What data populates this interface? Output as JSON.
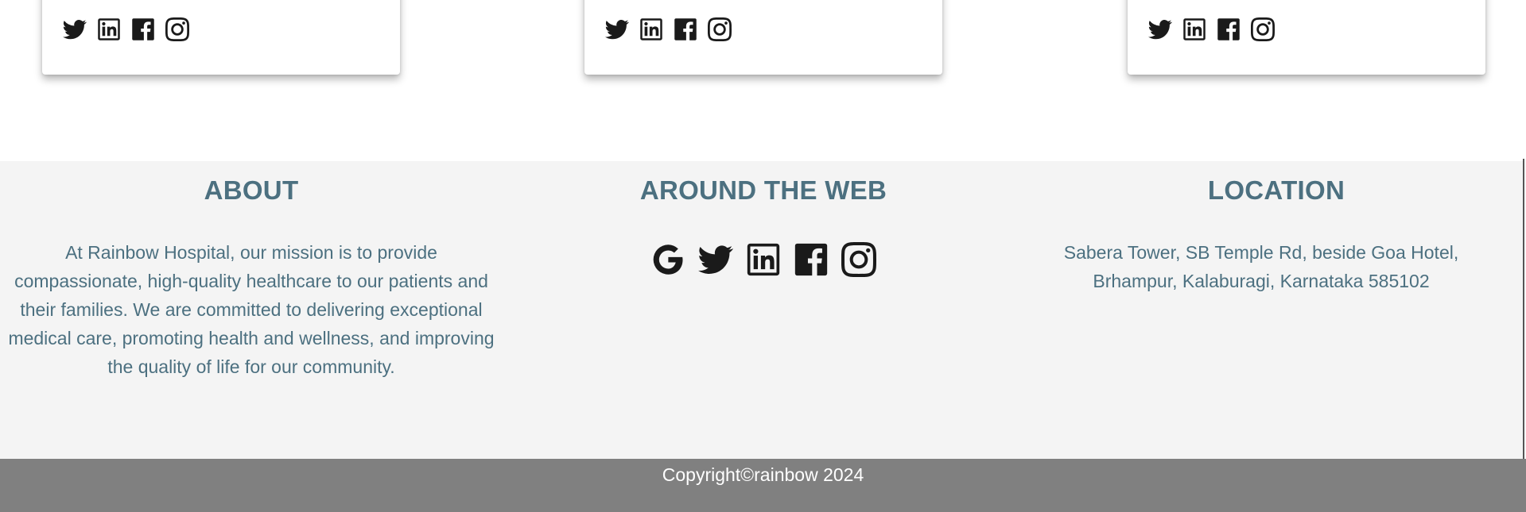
{
  "cards": [
    {
      "social": [
        "twitter-icon",
        "linkedin-icon",
        "facebook-icon",
        "instagram-icon"
      ]
    },
    {
      "social": [
        "twitter-icon",
        "linkedin-icon",
        "facebook-icon",
        "instagram-icon"
      ]
    },
    {
      "social": [
        "twitter-icon",
        "linkedin-icon",
        "facebook-icon",
        "instagram-icon"
      ]
    }
  ],
  "footer": {
    "about": {
      "heading": "ABOUT",
      "text": "At Rainbow Hospital, our mission is to provide compassionate, high-quality healthcare to our patients and their families. We are committed to delivering exceptional medical care, promoting health and wellness, and improving the quality of life for our community."
    },
    "web": {
      "heading": "AROUND THE WEB",
      "icons": [
        "google-icon",
        "twitter-icon",
        "linkedin-icon",
        "facebook-icon",
        "instagram-icon"
      ]
    },
    "location": {
      "heading": "LOCATION",
      "line1": "Sabera Tower, SB Temple Rd, beside Goa Hotel,",
      "line2": "Brhampur, Kalaburagi, Karnataka 585102"
    }
  },
  "copyright": "Copyright©rainbow 2024",
  "colors": {
    "footer_bg": "#f4f4f4",
    "heading_text": "#4c7080",
    "copyright_bg": "#808080",
    "copyright_text": "#ffffff",
    "icon": "#1a1a1a"
  }
}
